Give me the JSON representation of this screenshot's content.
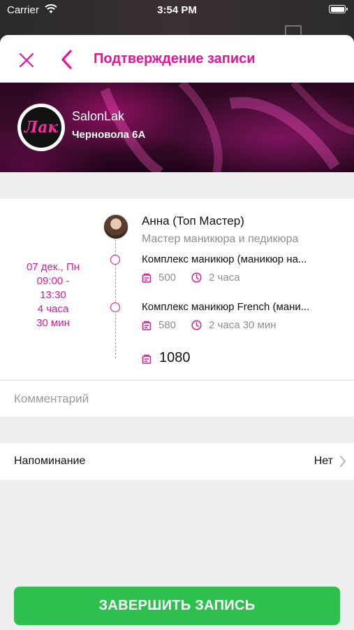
{
  "status_bar": {
    "carrier": "Carrier",
    "time": "3:54 PM"
  },
  "nav": {
    "title": "Подтверждение записи"
  },
  "salon": {
    "logo_text": "Лак",
    "name": "SalonLak",
    "address": "Черновола 6А"
  },
  "booking": {
    "date_lines": [
      "07 дек., Пн",
      "09:00 -",
      "13:30",
      "4 часа",
      "30 мин"
    ],
    "master": {
      "name": "Анна (Топ Мастер)",
      "role": "Мастер  маникюра и педикюра"
    },
    "services": [
      {
        "name": "Комплекс маникюр (маникюр на...",
        "price": "500",
        "duration": "2 часа"
      },
      {
        "name": "Комплекс маникюр French (мани...",
        "price": "580",
        "duration": "2 часа 30 мин"
      }
    ],
    "total": "1080"
  },
  "comment": {
    "placeholder": "Комментарий",
    "value": ""
  },
  "reminder": {
    "label": "Напоминание",
    "value": "Нет"
  },
  "complete_button": {
    "label": "ЗАВЕРШИТЬ ЗАПИСЬ"
  },
  "colors": {
    "accent": "#e0169a",
    "success": "#2fbf4f",
    "secondary_text": "#8e8e93"
  }
}
